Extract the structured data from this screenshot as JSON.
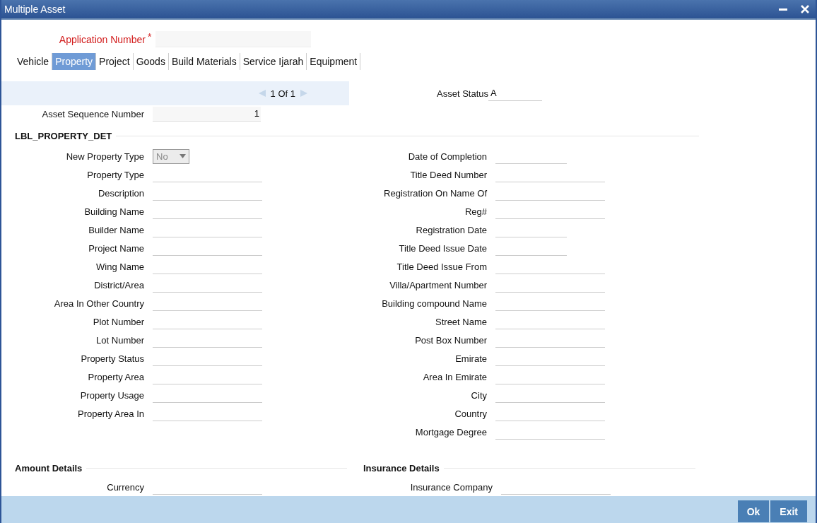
{
  "window": {
    "title": "Multiple Asset"
  },
  "application_number": {
    "label": "Application Number",
    "required_mark": "*"
  },
  "tabs": [
    {
      "label": "Vehicle",
      "selected": false
    },
    {
      "label": "Property",
      "selected": true
    },
    {
      "label": "Project",
      "selected": false
    },
    {
      "label": "Goods",
      "selected": false
    },
    {
      "label": "Build Materials",
      "selected": false
    },
    {
      "label": "Service Ijarah",
      "selected": false
    },
    {
      "label": "Equipment",
      "selected": false
    }
  ],
  "pager": {
    "text": "1 Of 1"
  },
  "asset_status": {
    "label": "Asset Status",
    "value": "A"
  },
  "asset_sequence": {
    "label": "Asset Sequence Number",
    "value": "1"
  },
  "property_section": {
    "title": "LBL_PROPERTY_DET",
    "left_fields": [
      {
        "label": "New Property Type",
        "kind": "select",
        "value": "No",
        "disabled": true
      },
      {
        "label": "Property Type",
        "kind": "text"
      },
      {
        "label": "Description",
        "kind": "text"
      },
      {
        "label": "Building Name",
        "kind": "text"
      },
      {
        "label": "Builder Name",
        "kind": "text"
      },
      {
        "label": "Project Name",
        "kind": "text"
      },
      {
        "label": "Wing Name",
        "kind": "text"
      },
      {
        "label": "District/Area",
        "kind": "text"
      },
      {
        "label": "Area In Other Country",
        "kind": "text"
      },
      {
        "label": "Plot Number",
        "kind": "text"
      },
      {
        "label": "Lot Number",
        "kind": "text"
      },
      {
        "label": "Property Status",
        "kind": "text"
      },
      {
        "label": "Property Area",
        "kind": "text"
      },
      {
        "label": "Property Usage",
        "kind": "text"
      },
      {
        "label": "Property Area In",
        "kind": "text"
      }
    ],
    "right_fields": [
      {
        "label": "Date of Completion",
        "kind": "date"
      },
      {
        "label": "Title Deed Number",
        "kind": "text"
      },
      {
        "label": "Registration On Name Of",
        "kind": "text"
      },
      {
        "label": "Reg#",
        "kind": "text"
      },
      {
        "label": "Registration Date",
        "kind": "date"
      },
      {
        "label": "Title Deed Issue Date",
        "kind": "date"
      },
      {
        "label": "Title Deed Issue From",
        "kind": "text"
      },
      {
        "label": "Villa/Apartment Number",
        "kind": "text"
      },
      {
        "label": "Building compound Name",
        "kind": "text"
      },
      {
        "label": "Street Name",
        "kind": "text"
      },
      {
        "label": "Post Box Number",
        "kind": "text"
      },
      {
        "label": "Emirate",
        "kind": "text"
      },
      {
        "label": "Area In Emirate",
        "kind": "text"
      },
      {
        "label": "City",
        "kind": "text"
      },
      {
        "label": "Country",
        "kind": "text"
      },
      {
        "label": "Mortgage Degree",
        "kind": "text"
      }
    ]
  },
  "amount_details": {
    "title": "Amount Details",
    "fields": [
      {
        "label": "Currency",
        "kind": "text"
      }
    ]
  },
  "insurance_details": {
    "title": "Insurance Details",
    "fields": [
      {
        "label": "Insurance Company",
        "kind": "text"
      }
    ]
  },
  "buttons": [
    "Ok",
    "Exit"
  ]
}
